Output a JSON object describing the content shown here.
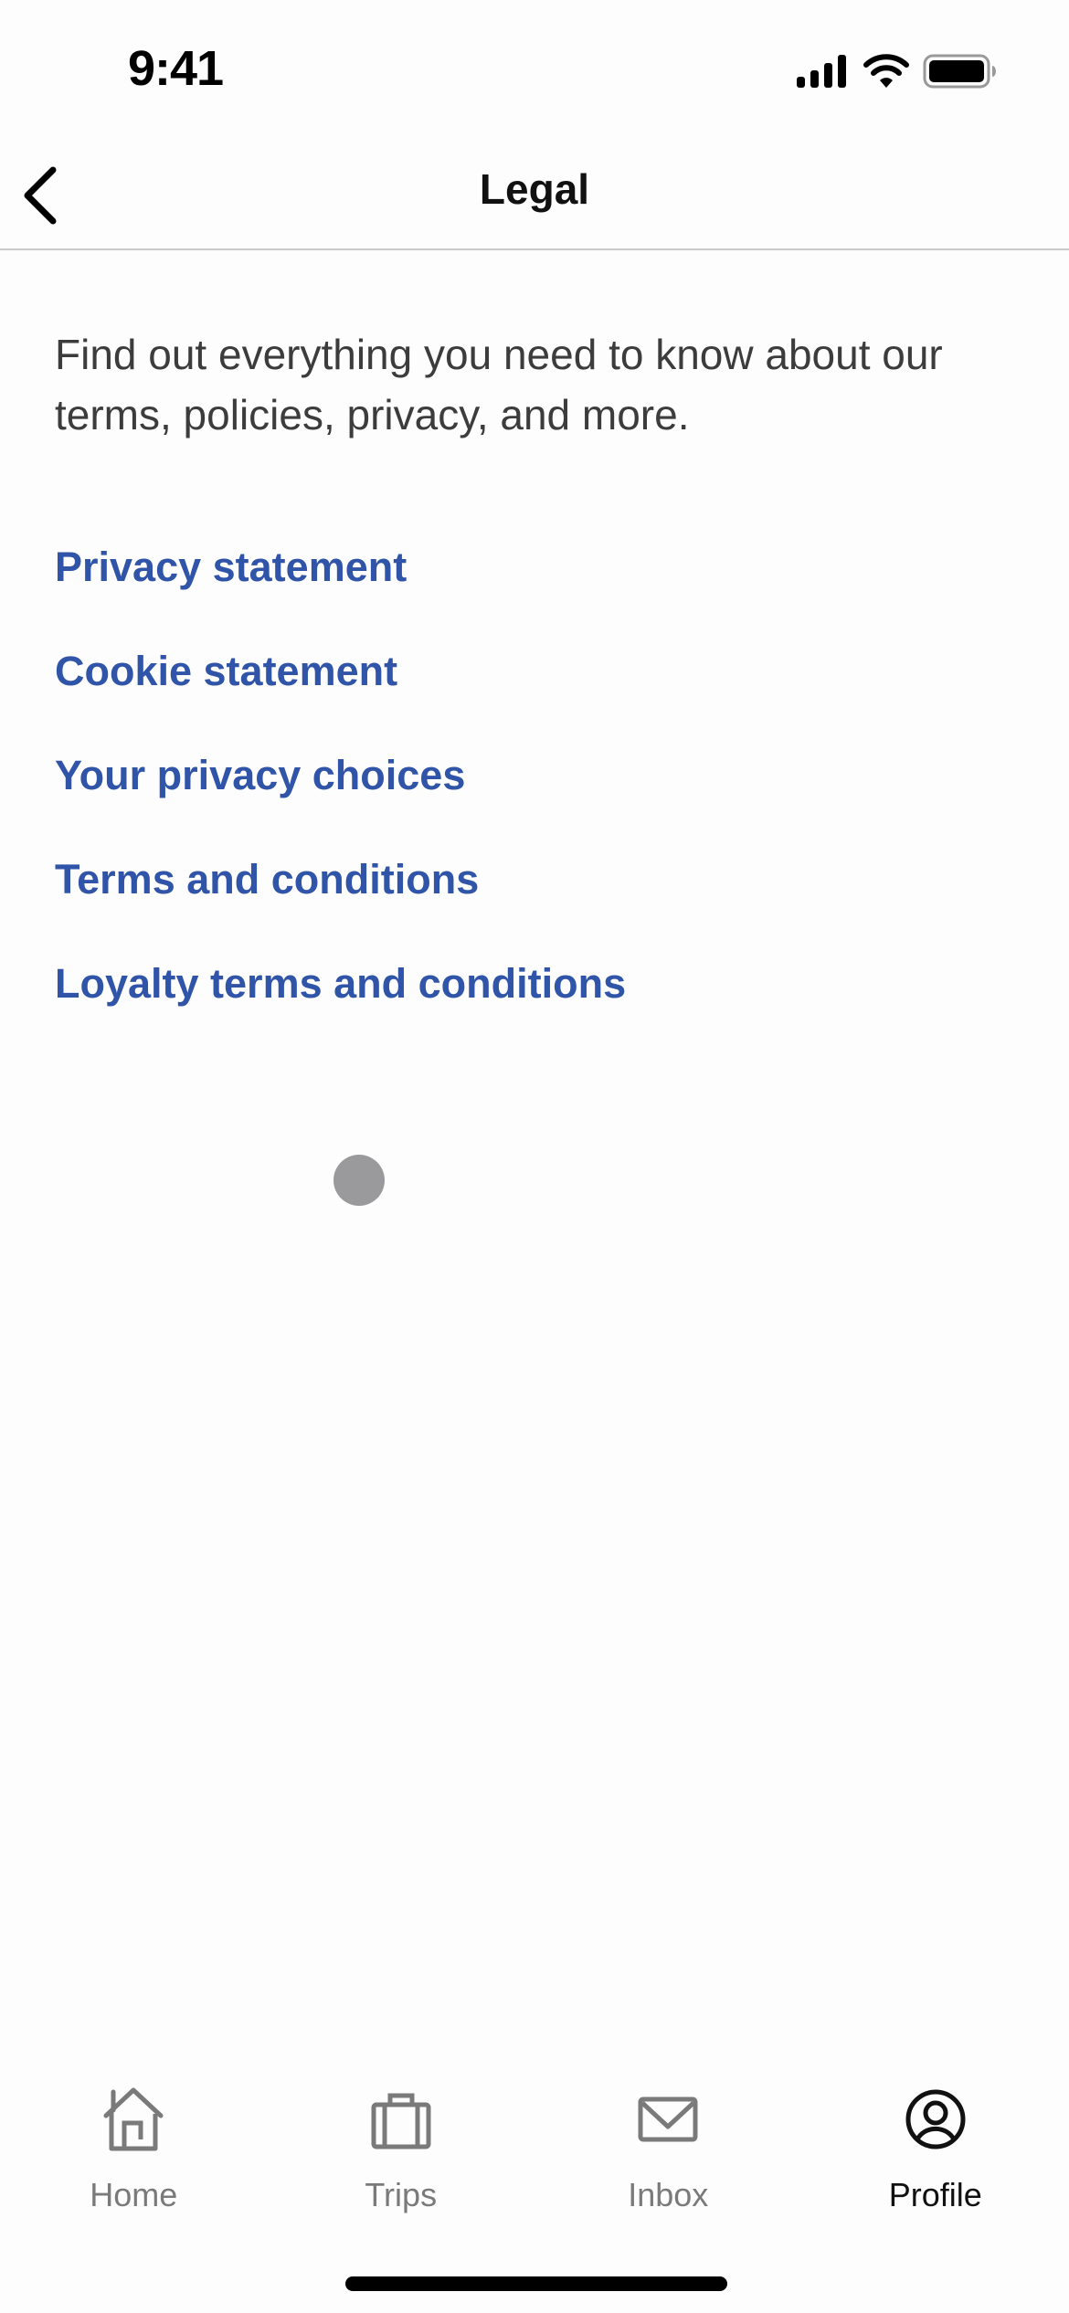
{
  "status_bar": {
    "time": "9:41",
    "icons": [
      "cellular-signal-icon",
      "wifi-icon",
      "battery-icon"
    ]
  },
  "nav": {
    "back_icon": "chevron-left-icon",
    "title": "Legal"
  },
  "description": "Find out everything you need to know about our terms, policies, privacy, and more.",
  "links": [
    {
      "label": "Privacy statement"
    },
    {
      "label": "Cookie statement"
    },
    {
      "label": "Your privacy choices"
    },
    {
      "label": "Terms and conditions"
    },
    {
      "label": "Loyalty terms and conditions"
    }
  ],
  "tabs": [
    {
      "label": "Home",
      "icon": "home-icon",
      "active": false
    },
    {
      "label": "Trips",
      "icon": "suitcase-icon",
      "active": false
    },
    {
      "label": "Inbox",
      "icon": "envelope-icon",
      "active": false
    },
    {
      "label": "Profile",
      "icon": "profile-icon",
      "active": true
    }
  ],
  "colors": {
    "link": "#2f54a8",
    "active_tab": "#111111",
    "inactive_tab": "#7a7a7a"
  }
}
